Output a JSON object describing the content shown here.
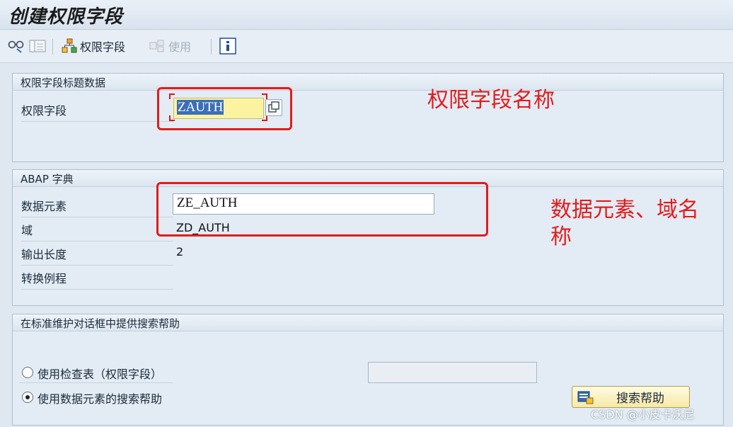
{
  "window": {
    "title": "创建权限字段"
  },
  "toolbar": {
    "auth_field_label": "权限字段",
    "use_label": "使用"
  },
  "section_header": {
    "title": "权限字段标题数据",
    "field_label": "权限字段",
    "field_value_selected": "ZAUTH"
  },
  "section_dict": {
    "title": "ABAP 字典",
    "data_element_label": "数据元素",
    "data_element_value": "ZE_AUTH",
    "domain_label": "域",
    "domain_value": "ZD_AUTH",
    "output_length_label": "输出长度",
    "output_length_value": "2",
    "conversion_label": "转换例程"
  },
  "section_search": {
    "title": "在标准维护对话框中提供搜索帮助",
    "option_check_table": "使用检查表（权限字段）",
    "option_data_element": "使用数据元素的搜索帮助",
    "selected_option": "option_data_element",
    "search_help_button": "搜索帮助"
  },
  "annotations": {
    "field_name_note": "权限字段名称",
    "data_element_note_line1": "数据元素、域名",
    "data_element_note_line2": "称",
    "color": "#e31b1b"
  },
  "watermark": "CSDN @小皮卡沃尼"
}
